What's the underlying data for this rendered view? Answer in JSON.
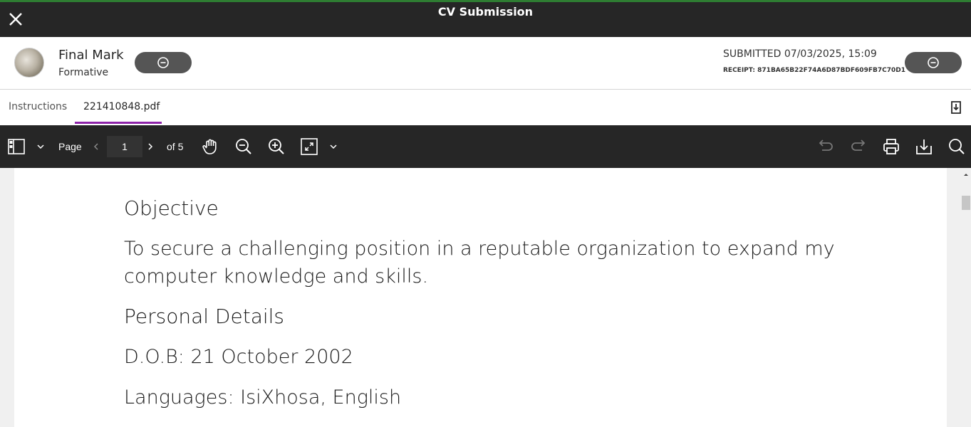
{
  "window": {
    "title": "CV Submission"
  },
  "header": {
    "mark_title": "Final Mark",
    "mark_subtitle": "Formative",
    "submitted": "SUBMITTED 07/03/2025, 15:09",
    "receipt": "RECEIPT: 871BA65B22F74A6D87BDF609FB7C70D1"
  },
  "tabs": [
    {
      "label": "Instructions"
    },
    {
      "label": "221410848.pdf",
      "active": true
    }
  ],
  "toolbar": {
    "page_label": "Page",
    "page_value": "1",
    "page_total": "of 5"
  },
  "document": {
    "heading_objective": "Objective",
    "objective_line1": "To secure a challenging position in a reputable organization to expand my",
    "objective_line2": "computer knowledge and skills.",
    "heading_personal": "Personal Details",
    "dob": "D.O.B:  21 October 2002",
    "languages": "Languages:  IsiXhosa, English"
  },
  "colors": {
    "topbar": "#262626",
    "accent_green": "#2e7d32",
    "tab_underline": "#8e24aa",
    "pill": "#555555"
  },
  "icons": [
    "close-icon",
    "minus-circle-icon",
    "download-icon",
    "sidebar-toggle-icon",
    "chevron-down-icon",
    "chevron-left-icon",
    "chevron-right-icon",
    "hand-icon",
    "zoom-out-icon",
    "zoom-in-icon",
    "fit-page-icon",
    "undo-icon",
    "redo-icon",
    "print-icon",
    "save-icon",
    "search-icon"
  ]
}
